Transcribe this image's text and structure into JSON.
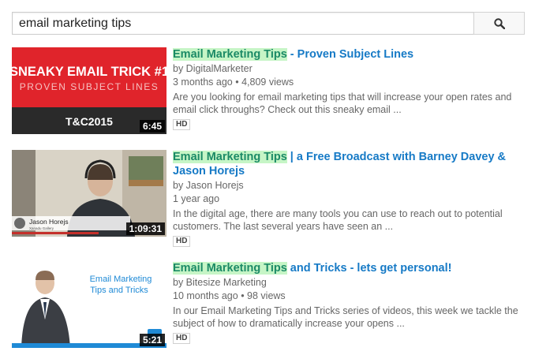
{
  "search": {
    "query": "email marketing tips",
    "icon": "search-icon"
  },
  "results": [
    {
      "title_highlight": "Email Marketing Tips",
      "title_rest": " - Proven Subject Lines",
      "channel": "by DigitalMarketer",
      "age": "3 months ago",
      "views": "4,809 views",
      "description": "Are you looking for email marketing tips that will increase your open rates and email click throughs? Check out this sneaky email ...",
      "badge": "HD",
      "duration": "6:45",
      "thumb": {
        "headline": "SNEAKY EMAIL TRICK #1",
        "subhead": "PROVEN SUBJECT LINES",
        "event": "T&C2015"
      },
      "colors": {
        "thumb_red": "#e0242b",
        "thumb_dark": "#2a2a2a"
      }
    },
    {
      "title_highlight": "Email Marketing Tips",
      "title_rest": " | a Free Broadcast with Barney Davey & Jason Horejs",
      "channel": "by Jason Horejs",
      "age": "1 year ago",
      "views": "",
      "description": "In the digital age, there are many tools you can use to reach out to potential customers. The last several years have seen an ...",
      "badge": "HD",
      "duration": "1:09:31",
      "thumb": {
        "caption_name": "Jason Horejs",
        "caption_sub": "Xanadu Gallery"
      }
    },
    {
      "title_highlight": "Email Marketing Tips",
      "title_rest": " and Tricks - lets get personal!",
      "channel": "by Bitesize Marketing",
      "age": "10 months ago",
      "views": "98 views",
      "description": "In our Email Marketing Tips and Tricks series of videos, this week we tackle the subject of how to dramatically increase your opens ...",
      "badge": "HD",
      "duration": "5:21",
      "thumb": {
        "text_line1": "Email Marketing",
        "text_line2": "Tips and Tricks"
      }
    }
  ]
}
